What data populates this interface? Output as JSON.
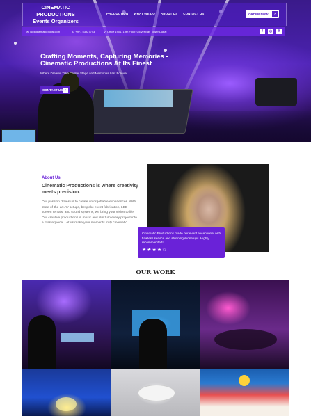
{
  "brand": {
    "line1": "CINEMATIC",
    "line2": "PRODUCTIONS",
    "line3": "Events Organizers"
  },
  "nav": [
    "PRODUCTION",
    "WHAT WE DO",
    "ABOUT US",
    "CONTACT US"
  ],
  "order_button": "ORDER NOW",
  "info": {
    "email": "hi@cinematicprods.com",
    "phone": "+971 53927743",
    "address": "Office 1901, 19th Floor, Clover Bay Tower Dubai"
  },
  "social": [
    "f",
    "◎",
    "X"
  ],
  "hero": {
    "title": "Crafting Moments, Capturing Memories - Cinematic Productions At Its Finest",
    "subtitle": "Where Dreams Take Center Stage and Memories Last Forever",
    "contact_button": "CONTACT US"
  },
  "about": {
    "label": "About Us",
    "title": "Cinematic Productions is where creativity meets precision.",
    "text": "Our passion drives us to create unforgettable experiences. With state-of-the-art AV setups, bespoke event fabrication, LED screen rentals, and sound systems, we bring your vision to life. Our creative productions in music and film turn every project into a masterpiece. Let us make your moments truly cinematic."
  },
  "review": {
    "text": "Cinematic Productions made our event exceptional with flawless service and stunning AV setups. Highly recommended!",
    "stars": "★★★★☆",
    "rating": 4
  },
  "work": {
    "title": "OUR WORK"
  },
  "colors": {
    "accent": "#6a22d8",
    "header_overlay": "#5a22c8"
  }
}
